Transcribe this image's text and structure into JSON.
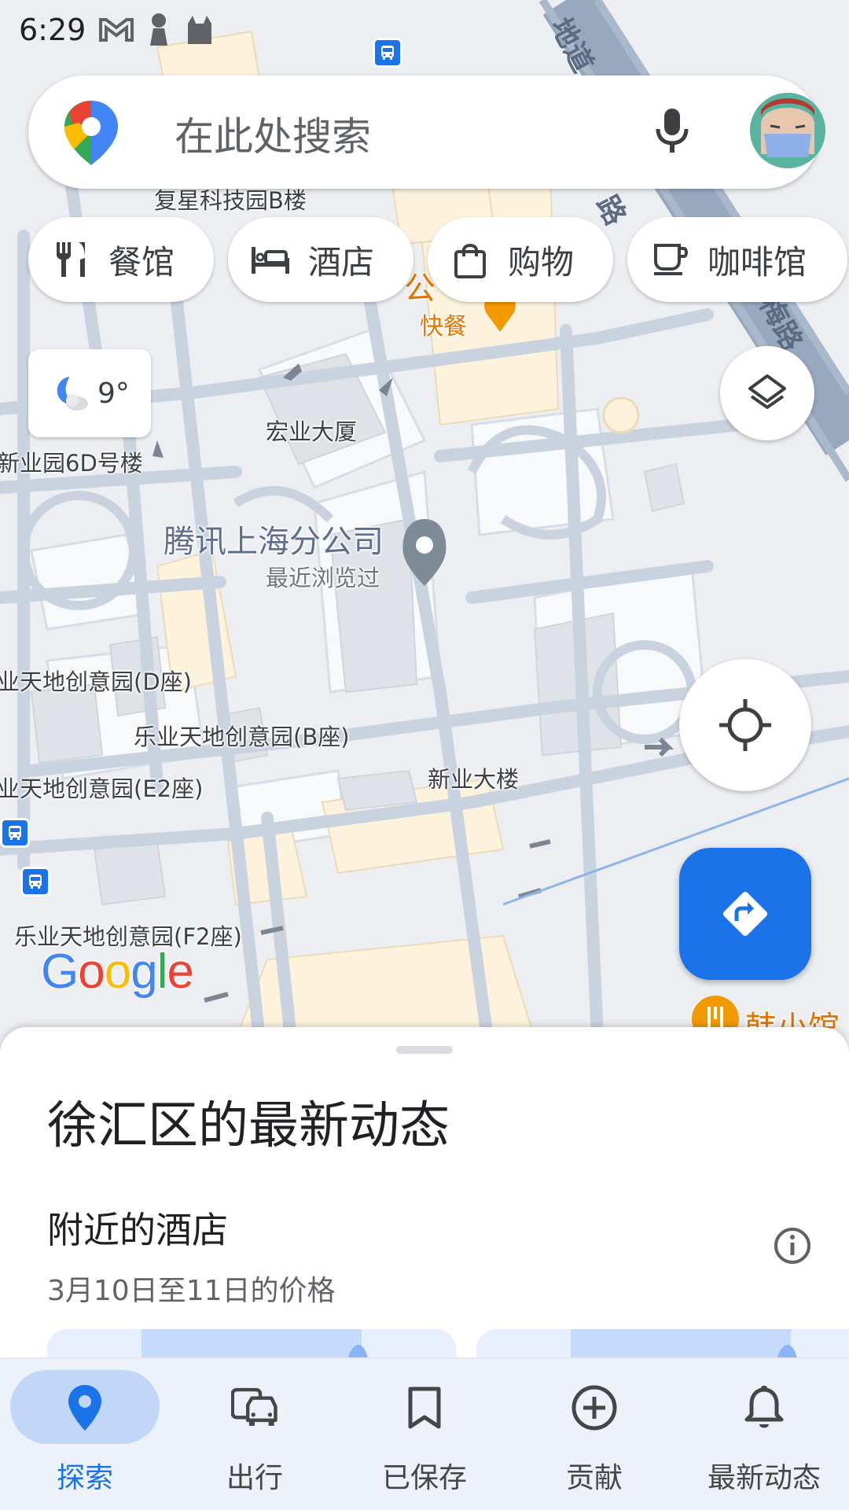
{
  "status_bar": {
    "time": "6:29"
  },
  "search": {
    "placeholder": "在此处搜索"
  },
  "chips": [
    {
      "label": "餐馆",
      "icon": "restaurant-icon"
    },
    {
      "label": "酒店",
      "icon": "hotel-bed-icon"
    },
    {
      "label": "购物",
      "icon": "shopping-bag-icon"
    },
    {
      "label": "咖啡馆",
      "icon": "coffee-cup-icon"
    }
  ],
  "weather": {
    "temp": "9°",
    "icon": "partly-cloudy-night-icon"
  },
  "map": {
    "labels": {
      "fuxing": "复星科技园B楼",
      "hongye": "宏业大厦",
      "xinye_6d": "新业园6D号楼",
      "tencent": "腾讯上海分公司",
      "recent": "最近浏览过",
      "leye_d": "业天地创意园(D座)",
      "leye_b": "乐业天地创意园(B座)",
      "xinye_building": "新业大楼",
      "leye_e2": "业天地创意园(E2座)",
      "leye_f2": "乐业天地创意园(F2座)",
      "kuaican": "快餐",
      "han_xiaoguan": "韩小馆",
      "gong_fragment": "公",
      "road_1": "路",
      "road_2": "地道",
      "road_3": "梅路"
    },
    "google_logo": "Google"
  },
  "sheet": {
    "title": "徐汇区的最新动态",
    "section_title": "附近的酒店",
    "section_subtitle": "3月10日至11日的价格"
  },
  "nav": [
    {
      "label": "探索",
      "icon": "explore-pin-icon",
      "active": true
    },
    {
      "label": "出行",
      "icon": "commute-car-bus-icon",
      "active": false
    },
    {
      "label": "已保存",
      "icon": "bookmark-icon",
      "active": false
    },
    {
      "label": "贡献",
      "icon": "add-circle-icon",
      "active": false
    },
    {
      "label": "最新动态",
      "icon": "notifications-bell-icon",
      "active": false
    }
  ],
  "colors": {
    "accent": "#1a73e8",
    "nav_bg": "#edf2fa",
    "active_pill": "#c2d7f8",
    "map_road": "#c9d3e0"
  }
}
